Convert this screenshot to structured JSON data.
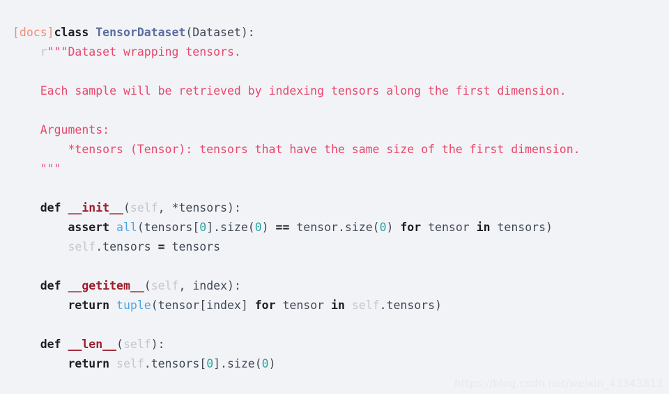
{
  "page": {
    "kind": "python-source-code-block",
    "background_color": "#f2f3f7",
    "default_text_color": "#3f4955"
  },
  "theme": {
    "docs_tag_color": "#f08d76",
    "keyword_color": "#1b1f24",
    "class_name_color": "#5a6e9e",
    "function_name_color": "#9c1d2b",
    "string_color": "#e8476b",
    "builtin_color": "#4da6e0",
    "self_color": "#c3c7cc",
    "number_color": "#2aa5a0",
    "plain_color": "#3f4955"
  },
  "code": {
    "language": "Python",
    "lines": [
      {
        "id": "line-1",
        "tokens": [
          {
            "t": "[docs]",
            "c": "docs"
          },
          {
            "t": "class",
            "c": "kw"
          },
          {
            "t": " ",
            "c": "plain"
          },
          {
            "t": "TensorDataset",
            "c": "classname"
          },
          {
            "t": "(Dataset):",
            "c": "plain"
          }
        ]
      },
      {
        "id": "line-2",
        "tokens": [
          {
            "t": "    ",
            "c": "plain"
          },
          {
            "t": "r",
            "c": "self"
          },
          {
            "t": "\"\"\"Dataset wrapping tensors.",
            "c": "string"
          }
        ]
      },
      {
        "id": "line-3",
        "tokens": []
      },
      {
        "id": "line-4",
        "tokens": [
          {
            "t": "    Each sample will be retrieved by indexing tensors along the first dimension.",
            "c": "string"
          }
        ]
      },
      {
        "id": "line-5",
        "tokens": []
      },
      {
        "id": "line-6",
        "tokens": [
          {
            "t": "    Arguments:",
            "c": "string"
          }
        ]
      },
      {
        "id": "line-7",
        "tokens": [
          {
            "t": "        *tensors (Tensor): tensors that have the same size of the first dimension.",
            "c": "string"
          }
        ]
      },
      {
        "id": "line-8",
        "tokens": [
          {
            "t": "    \"\"\"",
            "c": "string-dim"
          }
        ]
      },
      {
        "id": "line-9",
        "tokens": []
      },
      {
        "id": "line-10",
        "tokens": [
          {
            "t": "    ",
            "c": "plain"
          },
          {
            "t": "def",
            "c": "kw"
          },
          {
            "t": " ",
            "c": "plain"
          },
          {
            "t": "__init__",
            "c": "funcname"
          },
          {
            "t": "(",
            "c": "plain"
          },
          {
            "t": "self",
            "c": "self"
          },
          {
            "t": ", *tensors):",
            "c": "plain"
          }
        ]
      },
      {
        "id": "line-11",
        "tokens": [
          {
            "t": "        ",
            "c": "plain"
          },
          {
            "t": "assert",
            "c": "kw"
          },
          {
            "t": " ",
            "c": "plain"
          },
          {
            "t": "all",
            "c": "builtin"
          },
          {
            "t": "(tensors[",
            "c": "plain"
          },
          {
            "t": "0",
            "c": "num"
          },
          {
            "t": "].size(",
            "c": "plain"
          },
          {
            "t": "0",
            "c": "num"
          },
          {
            "t": ") ",
            "c": "plain"
          },
          {
            "t": "==",
            "c": "op"
          },
          {
            "t": " tensor.size(",
            "c": "plain"
          },
          {
            "t": "0",
            "c": "num"
          },
          {
            "t": ") ",
            "c": "plain"
          },
          {
            "t": "for",
            "c": "kw"
          },
          {
            "t": " tensor ",
            "c": "plain"
          },
          {
            "t": "in",
            "c": "kw"
          },
          {
            "t": " tensors)",
            "c": "plain"
          }
        ]
      },
      {
        "id": "line-12",
        "tokens": [
          {
            "t": "        ",
            "c": "plain"
          },
          {
            "t": "self",
            "c": "self"
          },
          {
            "t": ".tensors ",
            "c": "plain"
          },
          {
            "t": "=",
            "c": "op"
          },
          {
            "t": " tensors",
            "c": "plain"
          }
        ]
      },
      {
        "id": "line-13",
        "tokens": []
      },
      {
        "id": "line-14",
        "tokens": [
          {
            "t": "    ",
            "c": "plain"
          },
          {
            "t": "def",
            "c": "kw"
          },
          {
            "t": " ",
            "c": "plain"
          },
          {
            "t": "__getitem__",
            "c": "funcname"
          },
          {
            "t": "(",
            "c": "plain"
          },
          {
            "t": "self",
            "c": "self"
          },
          {
            "t": ", index):",
            "c": "plain"
          }
        ]
      },
      {
        "id": "line-15",
        "tokens": [
          {
            "t": "        ",
            "c": "plain"
          },
          {
            "t": "return",
            "c": "kw"
          },
          {
            "t": " ",
            "c": "plain"
          },
          {
            "t": "tuple",
            "c": "builtin"
          },
          {
            "t": "(tensor[index] ",
            "c": "plain"
          },
          {
            "t": "for",
            "c": "kw"
          },
          {
            "t": " tensor ",
            "c": "plain"
          },
          {
            "t": "in",
            "c": "kw"
          },
          {
            "t": " ",
            "c": "plain"
          },
          {
            "t": "self",
            "c": "self"
          },
          {
            "t": ".tensors)",
            "c": "plain"
          }
        ]
      },
      {
        "id": "line-16",
        "tokens": []
      },
      {
        "id": "line-17",
        "tokens": [
          {
            "t": "    ",
            "c": "plain"
          },
          {
            "t": "def",
            "c": "kw"
          },
          {
            "t": " ",
            "c": "plain"
          },
          {
            "t": "__len__",
            "c": "funcname"
          },
          {
            "t": "(",
            "c": "plain"
          },
          {
            "t": "self",
            "c": "self"
          },
          {
            "t": "):",
            "c": "plain"
          }
        ]
      },
      {
        "id": "line-18",
        "tokens": [
          {
            "t": "        ",
            "c": "plain"
          },
          {
            "t": "return",
            "c": "kw"
          },
          {
            "t": " ",
            "c": "plain"
          },
          {
            "t": "self",
            "c": "self"
          },
          {
            "t": ".tensors[",
            "c": "plain"
          },
          {
            "t": "0",
            "c": "num"
          },
          {
            "t": "].size(",
            "c": "plain"
          },
          {
            "t": "0",
            "c": "num"
          },
          {
            "t": ")",
            "c": "plain"
          }
        ]
      }
    ]
  },
  "watermark": {
    "text": "https://blog.csdn.net/weixin_43343813",
    "color": "#e7e9ee"
  }
}
